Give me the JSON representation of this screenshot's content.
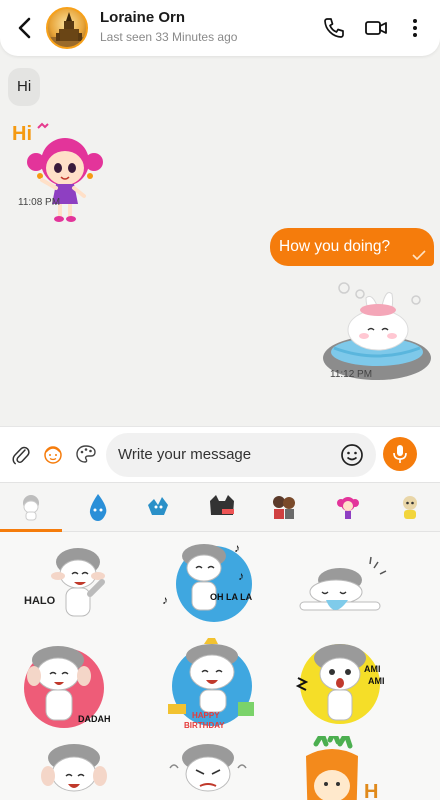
{
  "header": {
    "contact_name": "Loraine Orn",
    "last_seen": "Last seen 33 Minutes ago",
    "icons": [
      "back-arrow-icon",
      "phone-icon",
      "video-camera-icon",
      "more-vertical-icon"
    ]
  },
  "messages": [
    {
      "direction": "incoming",
      "type": "text",
      "text": "Hi"
    },
    {
      "direction": "incoming",
      "type": "sticker",
      "sticker_text": "Hi",
      "time": "11:08 PM"
    },
    {
      "direction": "outgoing",
      "type": "text",
      "text": "How you doing?"
    },
    {
      "direction": "outgoing",
      "type": "sticker",
      "time": "11:12 PM"
    }
  ],
  "composer": {
    "placeholder": "Write your message",
    "icons": [
      "attachment-icon",
      "avatar-sticker-icon",
      "paint-palette-icon",
      "emoji-icon",
      "microphone-icon"
    ]
  },
  "colors": {
    "accent": "#f57c0c",
    "background": "#f2f2f0"
  },
  "sticker_grid": {
    "texts": {
      "halo": "HALO",
      "oh_la_la": "OH LA LA",
      "dadah": "DADAH",
      "happy": "HAPPY",
      "birthday": "BIRTHDAY",
      "ami": "AMI",
      "h": "H"
    }
  }
}
